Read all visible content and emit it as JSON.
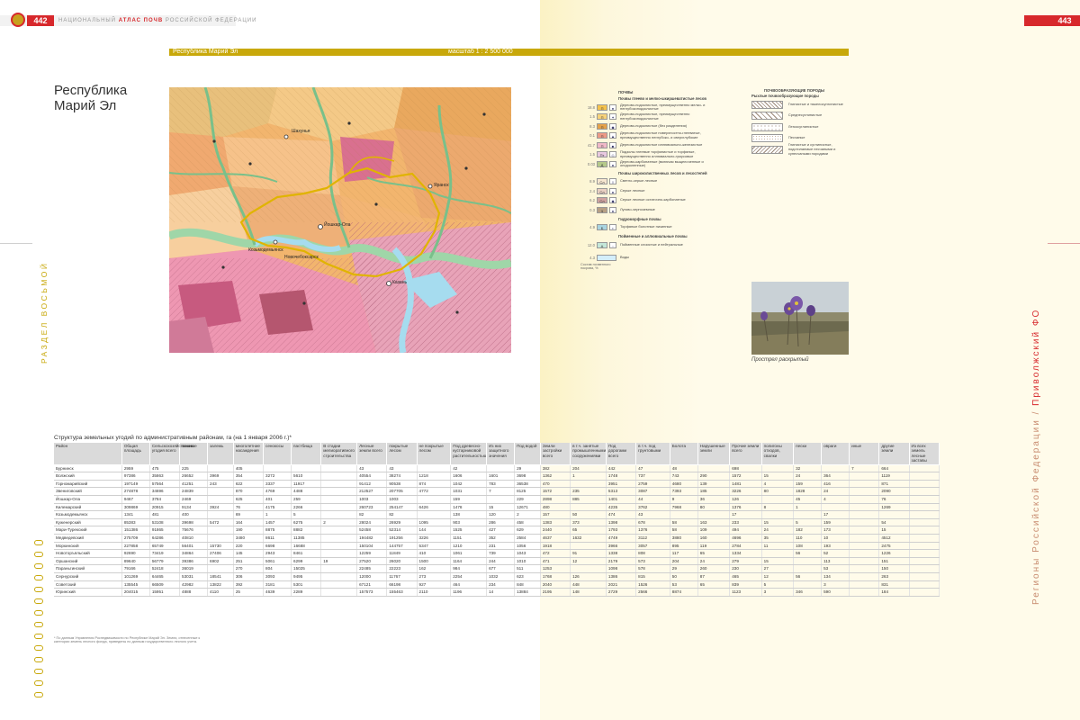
{
  "header": {
    "left_page_number": "442",
    "right_page_number": "443",
    "atlas_title_pre": "НАЦИОНАЛЬНЫЙ ",
    "atlas_title_bold": "АТЛАС ПОЧВ",
    "atlas_title_post": " РОССИЙСКОЙ ФЕДЕРАЦИИ"
  },
  "map_bar": {
    "title": "Республика Марий Эл",
    "scale": "масштаб 1 : 2 500 000"
  },
  "region_title_line1": "Республика",
  "region_title_line2": "Марий Эл",
  "map_labels": {
    "city1": "Шахунья",
    "city2": "Йошкар-Ола",
    "city3": "Казань",
    "city4": "Козьмодемьянск",
    "city5": "Новочебоксарск",
    "city6": "Яранск"
  },
  "colors": {
    "accent_red": "#d7282c",
    "accent_gold": "#c8a80a",
    "map_orange": "#f2b56e",
    "map_pink": "#e8a3b8",
    "map_green": "#9fd6a8",
    "map_water": "#a6dcef"
  },
  "legend": {
    "soils_header": "ПОЧВЫ",
    "group1_header": "Почвы глеево и мелко-шкиршеватистые лесов",
    "rows": [
      {
        "num": "18.8",
        "code": "П",
        "sym": "●",
        "color": "#f5c24c",
        "text": "Дерново-подзолистые, преимущественно мелко- и неглубокоподзолистые"
      },
      {
        "num": "1.5",
        "code": "П",
        "sym": "✦",
        "color": "#f7d27a",
        "text": "Дерново-подзолистые, преимущественно неглубокоподзолистые"
      },
      {
        "num": "8.3",
        "code": "П",
        "sym": "◆",
        "color": "#e5a24a",
        "text": "Дерново-подзолистые (без разделения)"
      },
      {
        "num": "0.1",
        "code": "П",
        "sym": "▲",
        "color": "#ed9a86",
        "text": "Дерново-подзолистые поверхностно-глееватые, преимущественно неглубоко- и сверхглубокие"
      },
      {
        "num": "41.7",
        "code": "П",
        "sym": "■",
        "color": "#f0b8c8",
        "text": "Дерново-подзолистые иллювиально-железистые"
      },
      {
        "num": "1.5",
        "code": "Пт",
        "sym": "◇",
        "color": "#e9c9e0",
        "text": "Подзолы глеевые торфянистые и торфяные, преимущественно иллювиально-гумусовые"
      },
      {
        "num": "0.03",
        "code": "Д",
        "sym": "●",
        "color": "#b5c98a",
        "text": "Дерново-карбонатные (включая выщелоченные и оподзоленные)"
      }
    ],
    "group2_header": "Почвы широколиственных лесов и лесостепей",
    "rows2": [
      {
        "num": "8.9",
        "code": "Сл",
        "sym": "◊",
        "color": "#f6e6d0",
        "text": "Светло-серые лесные"
      },
      {
        "num": "2.4",
        "code": "Сл",
        "sym": "●",
        "color": "#e8cfc2",
        "text": "Серые лесные"
      },
      {
        "num": "6.2",
        "code": "Сл",
        "sym": "◆",
        "color": "#cfa3a0",
        "text": "Серые лесные остаточно-карбонатные"
      },
      {
        "num": "0.3",
        "code": "Ч",
        "sym": "●",
        "color": "#b7a084",
        "text": "Лугово-черноземные"
      }
    ],
    "group3_header": "Гидроморфные почвы",
    "rows3": [
      {
        "num": "4.9",
        "code": "Б",
        "sym": "▪",
        "color": "#a9d4e0",
        "text": "Торфяные болотные низинные"
      }
    ],
    "group4_header": "Пойменные и аллювиальные почвы",
    "rows4": [
      {
        "num": "12.0",
        "code": "А",
        "sym": "▫",
        "color": "#c4e7d9",
        "text": "Пойменные слоистые и нейтральные"
      }
    ],
    "water_row": {
      "num": "4.3",
      "text": "Воды",
      "color": "#d3eefb"
    },
    "area_note": "Состав почвенного покрова, %"
  },
  "rocks": {
    "header": "ПОЧВООБРАЗУЮЩИЕ ПОРОДЫ",
    "subheader": "Рыхлые почвообразующие породы",
    "items": [
      {
        "text": "Глинистые и тяжелосуглинистые"
      },
      {
        "text": "Среднесуглинистые"
      },
      {
        "text": "Легкосуглинистые"
      },
      {
        "text": "Песчаные"
      },
      {
        "text": "Глинистые и суглинистые, подстилаемые песчаными и супесчаными породами"
      }
    ]
  },
  "photo_caption": "Прострел раскрытый",
  "side_left": "РАЗДЕЛ ВОСЬМОЙ",
  "side_right_pre": "Регионы Российской Федерации / ",
  "side_right_hl": "Приволжский ФО",
  "table": {
    "title": "Структура земельных угодий по административным районам, га (на 1 января 2006 г.)*",
    "headers": [
      "Район",
      "Общая площадь",
      "Сельскохозяйственные угодия всего",
      "пашня",
      "залежь",
      "многолетние насаждения",
      "сенокосы",
      "пастбища",
      "В стадии мелиоративного строительства",
      "Лесные земли всего",
      "покрытые лесом",
      "не покрытые лесом",
      "Под древесно-кустарниковой растительностью",
      "Из них защитного значения",
      "Под водой",
      "Земли застройки всего",
      "в т.ч. занятые промышленными сооружениями",
      "Под дорогами всего",
      "в т.ч. под грунтовыми",
      "Болота",
      "Нарушенные земли",
      "Прочие земли всего",
      "полигоны отходов, свалки",
      "пески",
      "овраги",
      "иные",
      "другие земли",
      "Из всех земель лесные заставы"
    ],
    "rows": [
      [
        "Бурнинск",
        "2959",
        "475",
        "225",
        "",
        "405",
        "",
        "",
        "",
        "43",
        "43",
        "",
        "42",
        "",
        "29",
        "382",
        "204",
        "442",
        "47",
        "48",
        "",
        "698",
        "",
        "32",
        "",
        "7",
        "664",
        ""
      ],
      [
        "Волжский",
        "97386",
        "35863",
        "26652",
        "3969",
        "354",
        "3272",
        "5610",
        "",
        "40554",
        "38274",
        "1218",
        "1606",
        "1601",
        "3698",
        "1362",
        "1",
        "1748",
        "737",
        "743",
        "290",
        "1572",
        "15",
        "24",
        "364",
        "",
        "1119",
        ""
      ],
      [
        "Горномарийский",
        "197149",
        "57564",
        "41251",
        "243",
        "622",
        "3337",
        "11917",
        "",
        "91412",
        "90538",
        "874",
        "1042",
        "783",
        "36538",
        "470",
        "",
        "3951",
        "2759",
        "4680",
        "139",
        "1481",
        "4",
        "159",
        "416",
        "",
        "871",
        ""
      ],
      [
        "Звениговский",
        "274878",
        "34696",
        "24839",
        "",
        "870",
        "4769",
        "4488",
        "",
        "212527",
        "207705",
        "4772",
        "1031",
        "7",
        "8125",
        "1572",
        "235",
        "5313",
        "3087",
        "7393",
        "185",
        "3226",
        "80",
        "1828",
        "24",
        "",
        "2090",
        ""
      ],
      [
        "Йошкар-Ола",
        "9467",
        "3784",
        "2469",
        "",
        "625",
        "401",
        "259",
        "",
        "1003",
        "1003",
        "",
        "159",
        "",
        "229",
        "2898",
        "885",
        "1401",
        "44",
        "9",
        "36",
        "126",
        "",
        "45",
        "4",
        "",
        "76",
        ""
      ],
      [
        "Килемарский",
        "309869",
        "20915",
        "9134",
        "3924",
        "76",
        "4175",
        "2266",
        "",
        "260723",
        "254147",
        "6426",
        "1478",
        "15",
        "12671",
        "480",
        "",
        "4235",
        "3762",
        "7968",
        "80",
        "1376",
        "8",
        "1",
        "",
        "",
        "1269",
        ""
      ],
      [
        "Козьмодемьянск",
        "1341",
        "481",
        "400",
        "",
        "69",
        "1",
        "5",
        "",
        "82",
        "82",
        "",
        "138",
        "120",
        "2",
        "157",
        "50",
        "474",
        "43",
        "",
        "",
        "17",
        "",
        "",
        "17",
        "",
        "",
        ""
      ],
      [
        "Куженерский",
        "85383",
        "53108",
        "39698",
        "5472",
        "164",
        "1457",
        "6275",
        "2",
        "28024",
        "26929",
        "1095",
        "903",
        "286",
        "458",
        "1383",
        "373",
        "1398",
        "678",
        "58",
        "163",
        "233",
        "15",
        "5",
        "159",
        "",
        "54",
        ""
      ],
      [
        "Мари-Турекский",
        "151386",
        "91865",
        "75676",
        "",
        "190",
        "8875",
        "8882",
        "",
        "52458",
        "52314",
        "144",
        "1525",
        "427",
        "629",
        "2440",
        "65",
        "1793",
        "1376",
        "58",
        "109",
        "494",
        "24",
        "182",
        "173",
        "",
        "15",
        ""
      ],
      [
        "Медведевский",
        "275709",
        "64286",
        "40810",
        "",
        "3480",
        "8611",
        "11385",
        "",
        "194482",
        "191256",
        "3226",
        "1151",
        "352",
        "2584",
        "4637",
        "1632",
        "4749",
        "3112",
        "3880",
        "160",
        "4696",
        "35",
        "110",
        "10",
        "",
        "4512",
        ""
      ],
      [
        "Моркинский",
        "227858",
        "65749",
        "56401",
        "15730",
        "220",
        "6698",
        "16688",
        "",
        "150104",
        "144757",
        "5347",
        "1210",
        "231",
        "1056",
        "1918",
        "",
        "3966",
        "3057",
        "895",
        "119",
        "2784",
        "11",
        "108",
        "193",
        "",
        "2475",
        ""
      ],
      [
        "Новоторъяльский",
        "92690",
        "73419",
        "34864",
        "27406",
        "145",
        "2943",
        "8461",
        "",
        "12259",
        "11849",
        "410",
        "1061",
        "739",
        "1043",
        "472",
        "91",
        "1338",
        "808",
        "117",
        "65",
        "1334",
        "",
        "56",
        "52",
        "",
        "1226",
        ""
      ],
      [
        "Оршанский",
        "89640",
        "56779",
        "39386",
        "6902",
        "251",
        "5061",
        "6299",
        "19",
        "27520",
        "26020",
        "1500",
        "1164",
        "244",
        "1010",
        "471",
        "12",
        "2179",
        "573",
        "204",
        "24",
        "279",
        "15",
        "",
        "113",
        "",
        "151",
        ""
      ],
      [
        "Параньгинский",
        "79166",
        "52418",
        "36019",
        "",
        "270",
        "804",
        "15025",
        "",
        "22485",
        "22223",
        "162",
        "984",
        "677",
        "511",
        "1253",
        "",
        "1098",
        "578",
        "29",
        "260",
        "230",
        "27",
        "",
        "53",
        "",
        "150",
        ""
      ],
      [
        "Сернурский",
        "101269",
        "64465",
        "53031",
        "18541",
        "306",
        "3093",
        "9495",
        "",
        "12000",
        "11767",
        "273",
        "2254",
        "1032",
        "623",
        "1768",
        "126",
        "1386",
        "815",
        "50",
        "87",
        "465",
        "12",
        "56",
        "134",
        "",
        "263",
        ""
      ],
      [
        "Советский",
        "135545",
        "66509",
        "42982",
        "13822",
        "392",
        "3181",
        "5301",
        "",
        "67121",
        "66198",
        "927",
        "464",
        "234",
        "848",
        "2040",
        "448",
        "2021",
        "1526",
        "53",
        "65",
        "839",
        "5",
        "",
        "3",
        "",
        "831",
        ""
      ],
      [
        "Юринский",
        "204015",
        "15951",
        "4888",
        "4110",
        "25",
        "4639",
        "2289",
        "",
        "157573",
        "155463",
        "2110",
        "1196",
        "14",
        "13884",
        "2195",
        "148",
        "2729",
        "2566",
        "8874",
        "",
        "1123",
        "3",
        "346",
        "590",
        "",
        "184",
        ""
      ]
    ]
  },
  "footnote": "* По данным Управления Роснедвижимости по Республике Марий Эл. Земли, отнесенные к категории земель лесного фонда, приведены по данным государственного лесного учета."
}
